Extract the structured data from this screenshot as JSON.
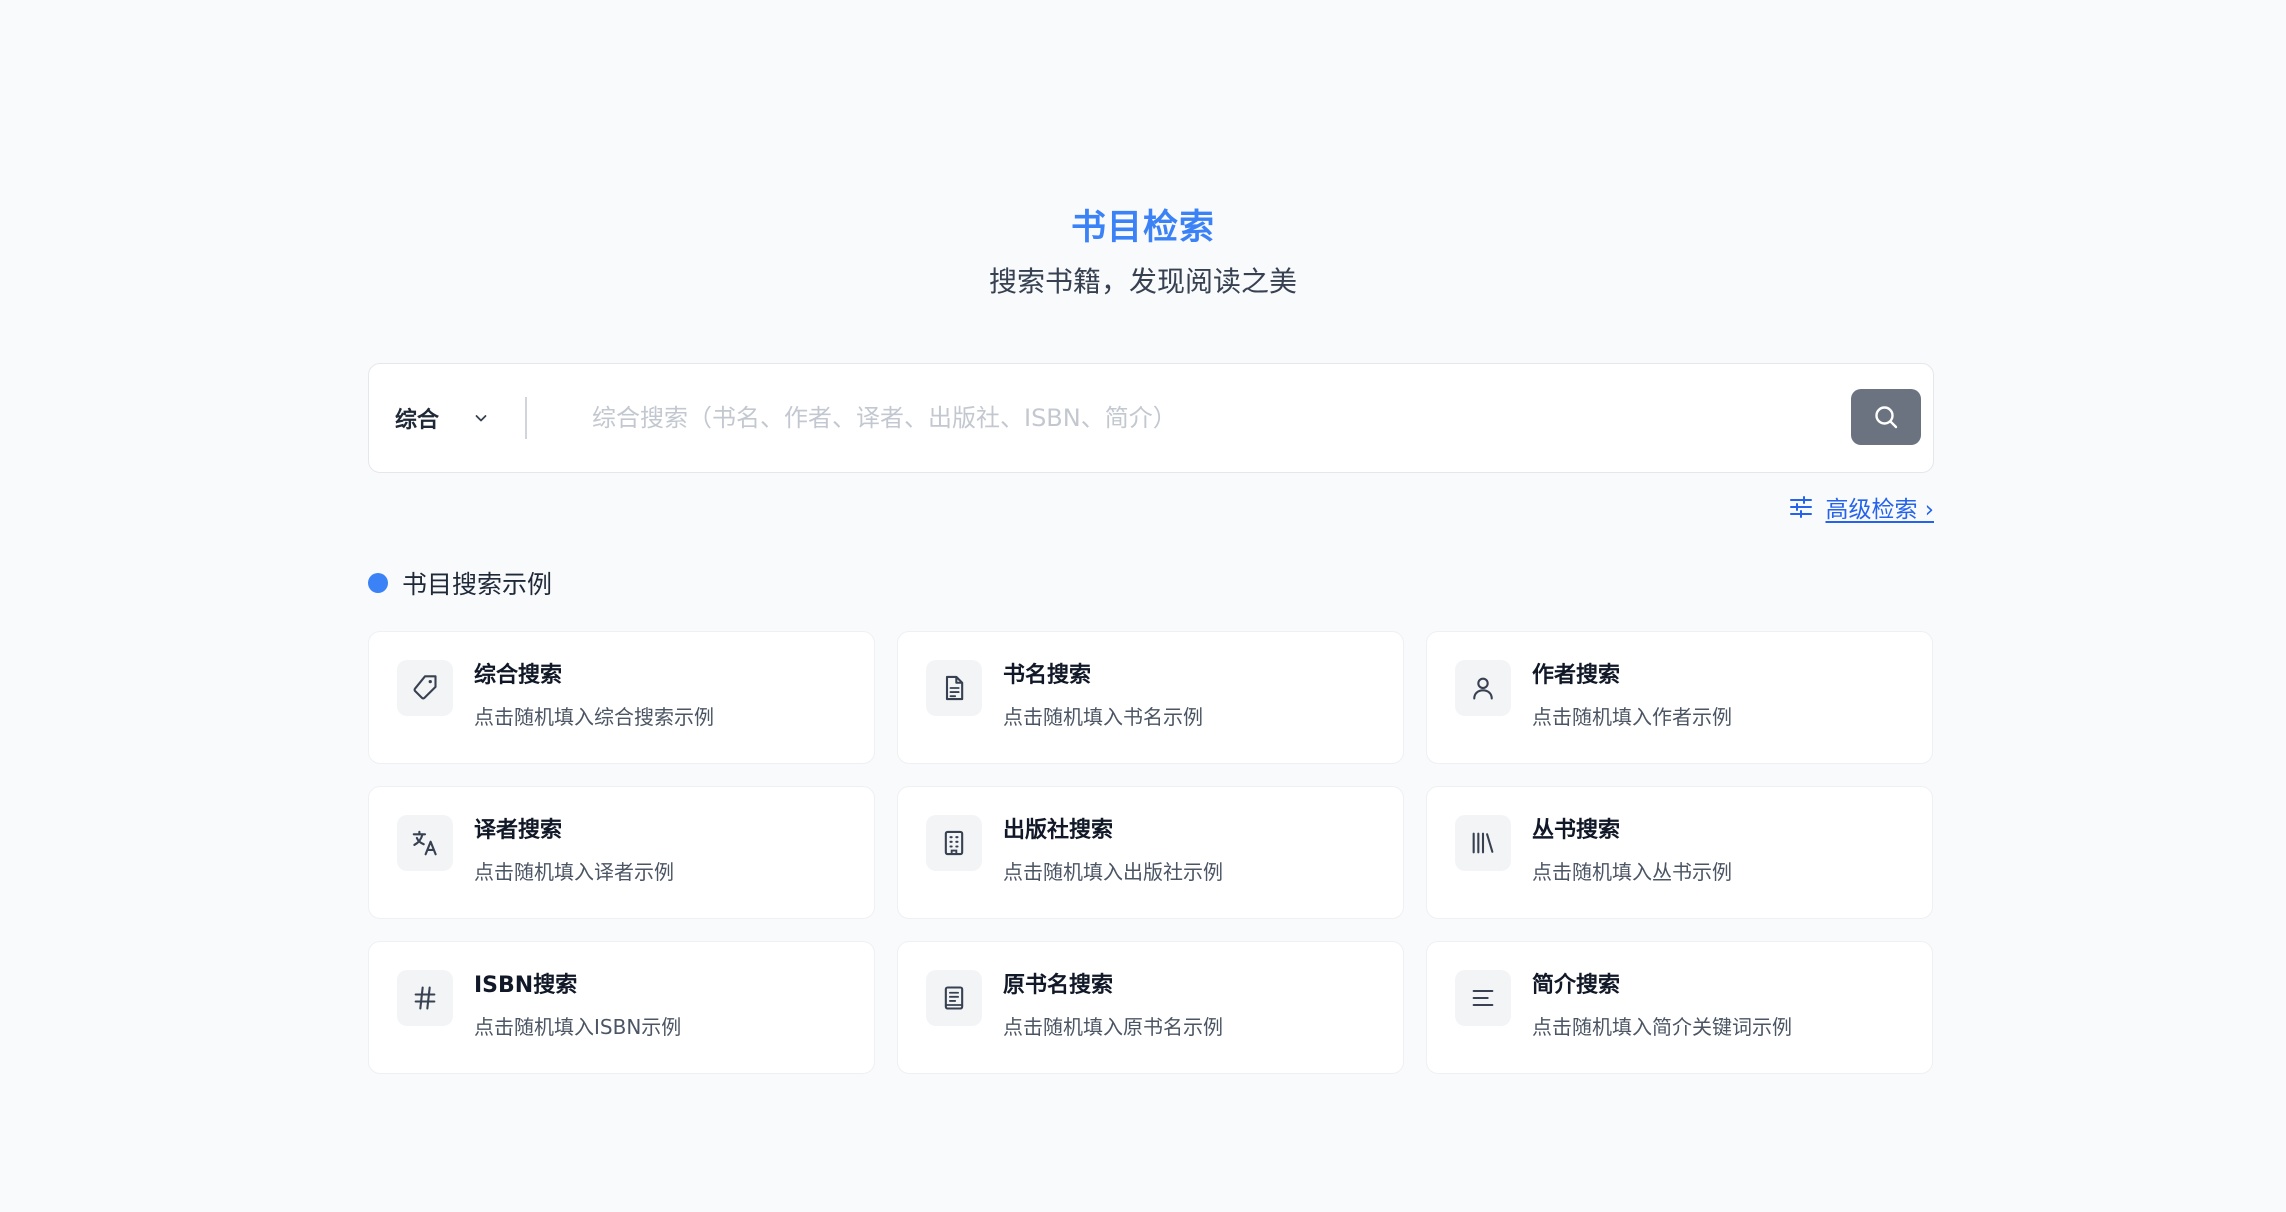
{
  "header": {
    "title": "书目检索",
    "subtitle": "搜索书籍，发现阅读之美"
  },
  "search": {
    "type_label": "综合",
    "placeholder": "综合搜索（书名、作者、译者、出版社、ISBN、简介）",
    "value": "",
    "button_icon": "search-icon"
  },
  "advanced": {
    "label": "高级检索 ›",
    "icon": "sliders-icon"
  },
  "examples": {
    "section_title": "书目搜索示例",
    "cards": [
      {
        "title": "综合搜索",
        "desc": "点击随机填入综合搜索示例",
        "icon": "tag-icon"
      },
      {
        "title": "书名搜索",
        "desc": "点击随机填入书名示例",
        "icon": "file-text-icon"
      },
      {
        "title": "作者搜索",
        "desc": "点击随机填入作者示例",
        "icon": "user-icon"
      },
      {
        "title": "译者搜索",
        "desc": "点击随机填入译者示例",
        "icon": "translate-icon"
      },
      {
        "title": "出版社搜索",
        "desc": "点击随机填入出版社示例",
        "icon": "building-icon"
      },
      {
        "title": "丛书搜索",
        "desc": "点击随机填入丛书示例",
        "icon": "library-icon"
      },
      {
        "title": "ISBN搜索",
        "desc": "点击随机填入ISBN示例",
        "icon": "hash-icon"
      },
      {
        "title": "原书名搜索",
        "desc": "点击随机填入原书名示例",
        "icon": "book-icon"
      },
      {
        "title": "简介搜索",
        "desc": "点击随机填入简介关键词示例",
        "icon": "align-left-icon"
      }
    ]
  },
  "colors": {
    "accent": "#3b82f6",
    "link": "#2563eb",
    "search_button": "#6b7280",
    "background": "#f8fafc"
  }
}
